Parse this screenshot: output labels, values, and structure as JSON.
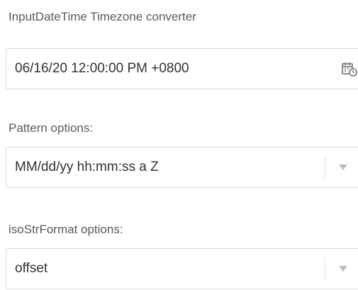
{
  "inputDateTime": {
    "label": "InputDateTime Timezone converter",
    "value": "06/16/20 12:00:00 PM +0800",
    "icon": "calendar-clock-icon"
  },
  "pattern": {
    "label": "Pattern options:",
    "selected": "MM/dd/yy hh:mm:ss a Z",
    "dropdown_icon": "chevron-down-icon"
  },
  "isoStrFormat": {
    "label": "isoStrFormat options:",
    "selected": "offset",
    "dropdown_icon": "chevron-down-icon"
  }
}
